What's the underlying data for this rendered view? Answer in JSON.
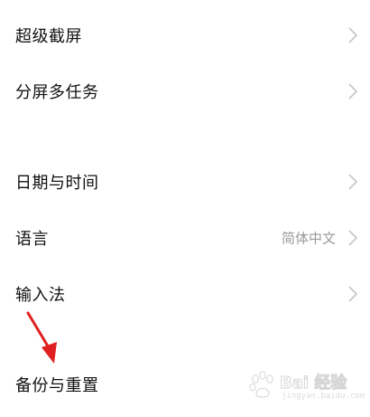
{
  "settings": {
    "items": [
      {
        "label": "超级截屏",
        "value": ""
      },
      {
        "label": "分屏多任务",
        "value": ""
      },
      {
        "label": "日期与时间",
        "value": ""
      },
      {
        "label": "语言",
        "value": "简体中文"
      },
      {
        "label": "输入法",
        "value": ""
      },
      {
        "label": "备份与重置",
        "value": ""
      }
    ]
  },
  "watermark": {
    "brand": "Bai 经验",
    "url": "jingyan.baidu.com"
  },
  "colors": {
    "label": "#111111",
    "value": "#9a9a9a",
    "chevron": "#c4c4c4",
    "annotation_arrow": "#e02020"
  }
}
